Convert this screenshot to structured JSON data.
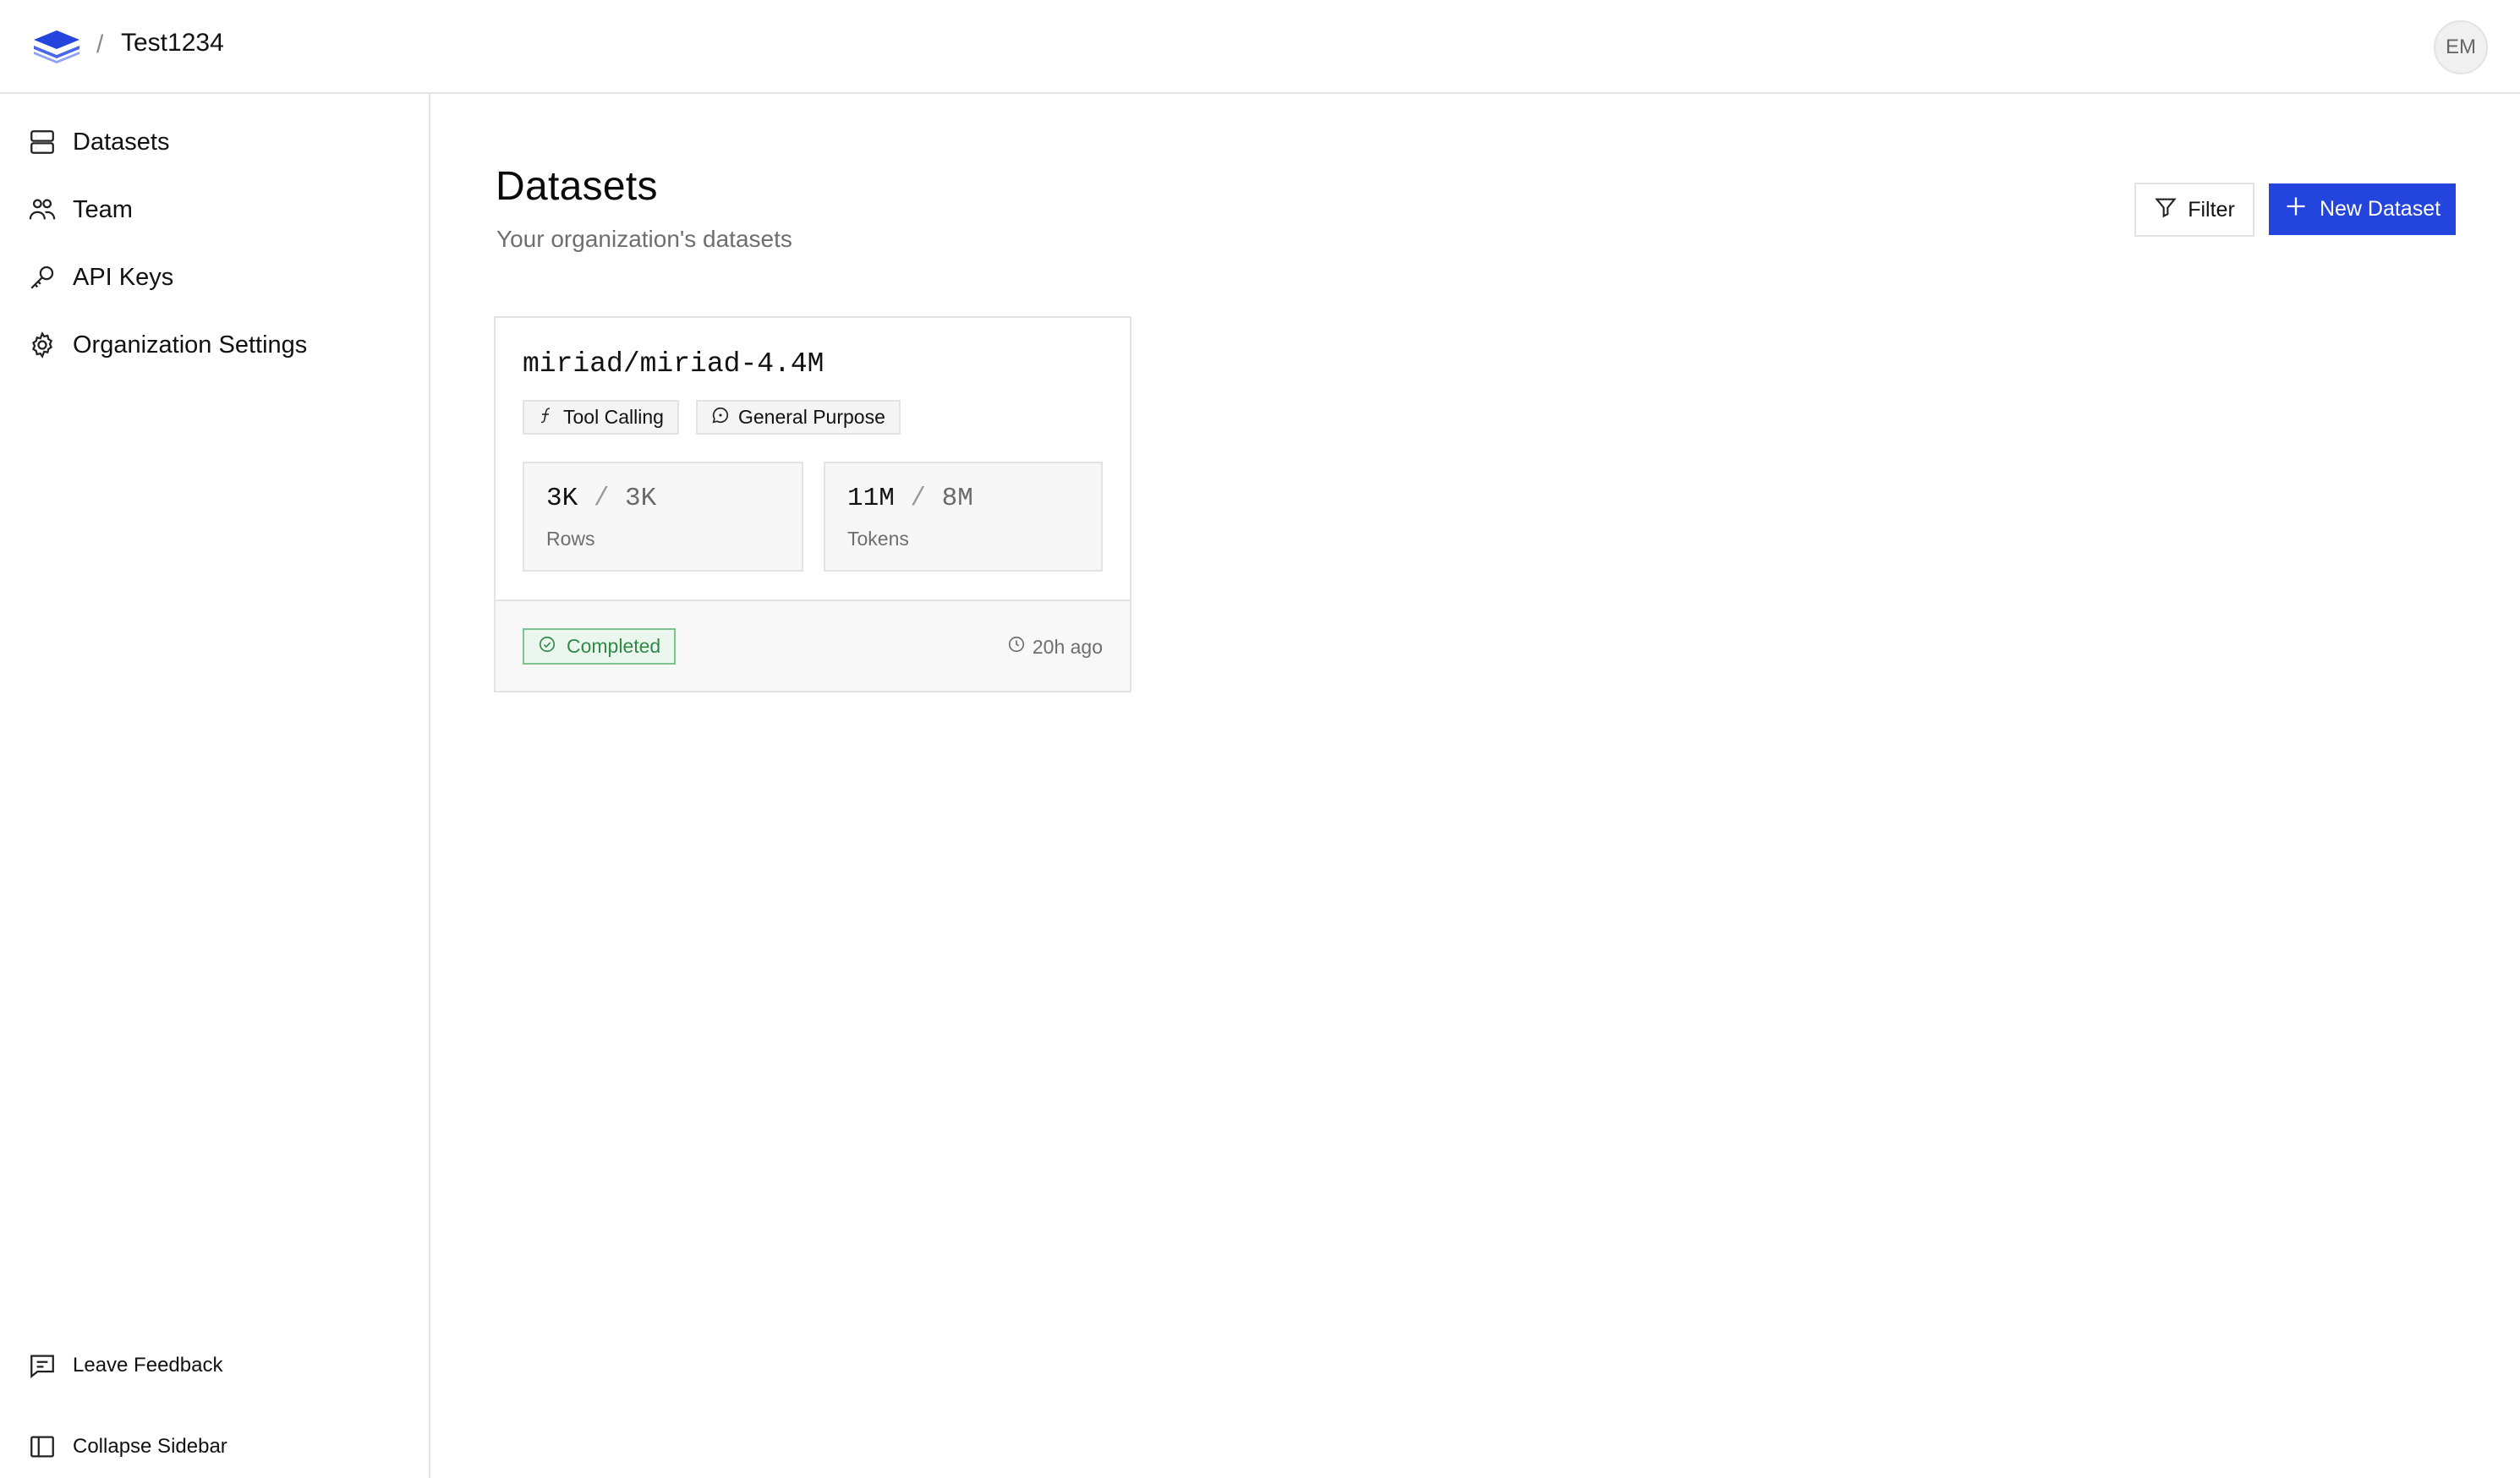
{
  "header": {
    "breadcrumb_separator": "/",
    "org_name": "Test1234",
    "avatar_initials": "EM"
  },
  "sidebar": {
    "items": [
      {
        "label": "Datasets",
        "icon": "database-icon"
      },
      {
        "label": "Team",
        "icon": "users-icon"
      },
      {
        "label": "API Keys",
        "icon": "key-icon"
      },
      {
        "label": "Organization Settings",
        "icon": "gear-icon"
      }
    ],
    "footer": [
      {
        "label": "Leave Feedback",
        "icon": "message-square-icon"
      },
      {
        "label": "Collapse Sidebar",
        "icon": "sidebar-panel-icon"
      }
    ]
  },
  "main": {
    "title": "Datasets",
    "subtitle": "Your organization's datasets",
    "filter_label": "Filter",
    "new_dataset_label": "New Dataset"
  },
  "datasets": [
    {
      "name": "miriad/miriad-4.4M",
      "tags": [
        {
          "label": "Tool Calling",
          "icon": "function-icon"
        },
        {
          "label": "General Purpose",
          "icon": "chat-bubble-icon"
        }
      ],
      "rows": {
        "current": "3K",
        "total": "3K",
        "label": "Rows"
      },
      "tokens": {
        "current": "11M",
        "total": "8M",
        "label": "Tokens"
      },
      "status": "Completed",
      "updated": "20h ago"
    }
  ],
  "colors": {
    "accent": "#2345de",
    "status_green": "#2f8a45",
    "border": "#e3e3e3"
  }
}
